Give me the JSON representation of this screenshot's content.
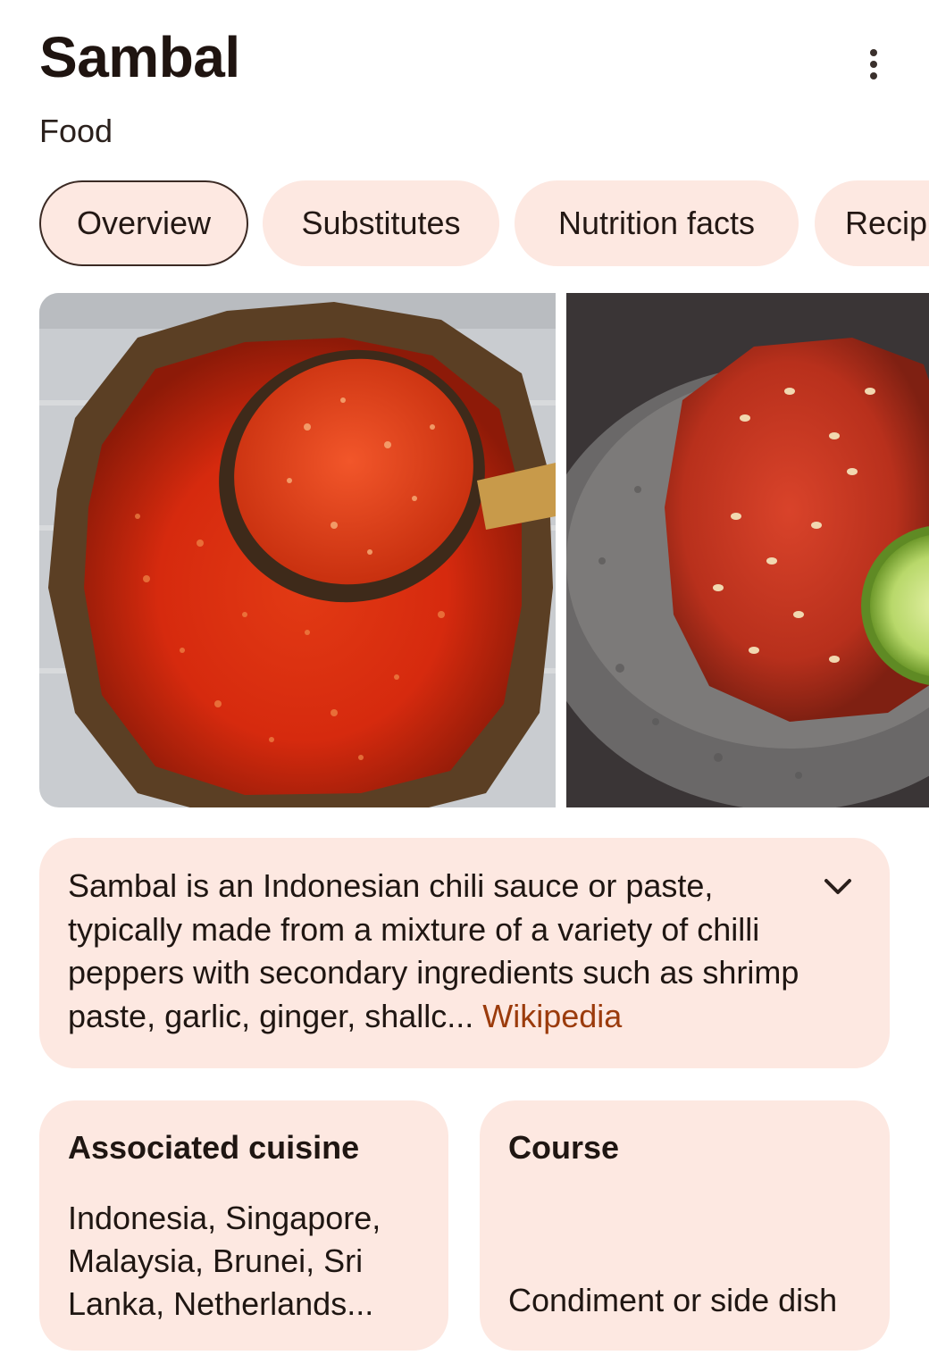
{
  "header": {
    "title": "Sambal",
    "subtitle": "Food",
    "more_icon": "more-vertical-icon"
  },
  "tabs": [
    {
      "label": "Overview",
      "active": true
    },
    {
      "label": "Substitutes",
      "active": false
    },
    {
      "label": "Nutrition facts",
      "active": false
    },
    {
      "label": "Recip",
      "active": false
    }
  ],
  "images": [
    {
      "content": "sambal-in-wooden-bowl-with-ladle"
    },
    {
      "content": "sambal-in-stone-mortar-with-lime"
    }
  ],
  "description": {
    "text": "Sambal is an Indonesian chili sauce or paste, typically made from a mixture of a variety of chilli peppers with secondary ingredients such as shrimp paste, garlic, ginger, shallc... ",
    "source": "Wikipedia",
    "expand_icon": "chevron-down-icon"
  },
  "facts": [
    {
      "title": "Associated cuisine",
      "value": "Indonesia, Singapore, Malaysia, Brunei, Sri Lanka, Netherlands..."
    },
    {
      "title": "Course",
      "value": "Condiment or side dish"
    }
  ],
  "colors": {
    "card_background": "#fde8e1",
    "link": "#9b3b0c",
    "text": "#1f1410"
  }
}
